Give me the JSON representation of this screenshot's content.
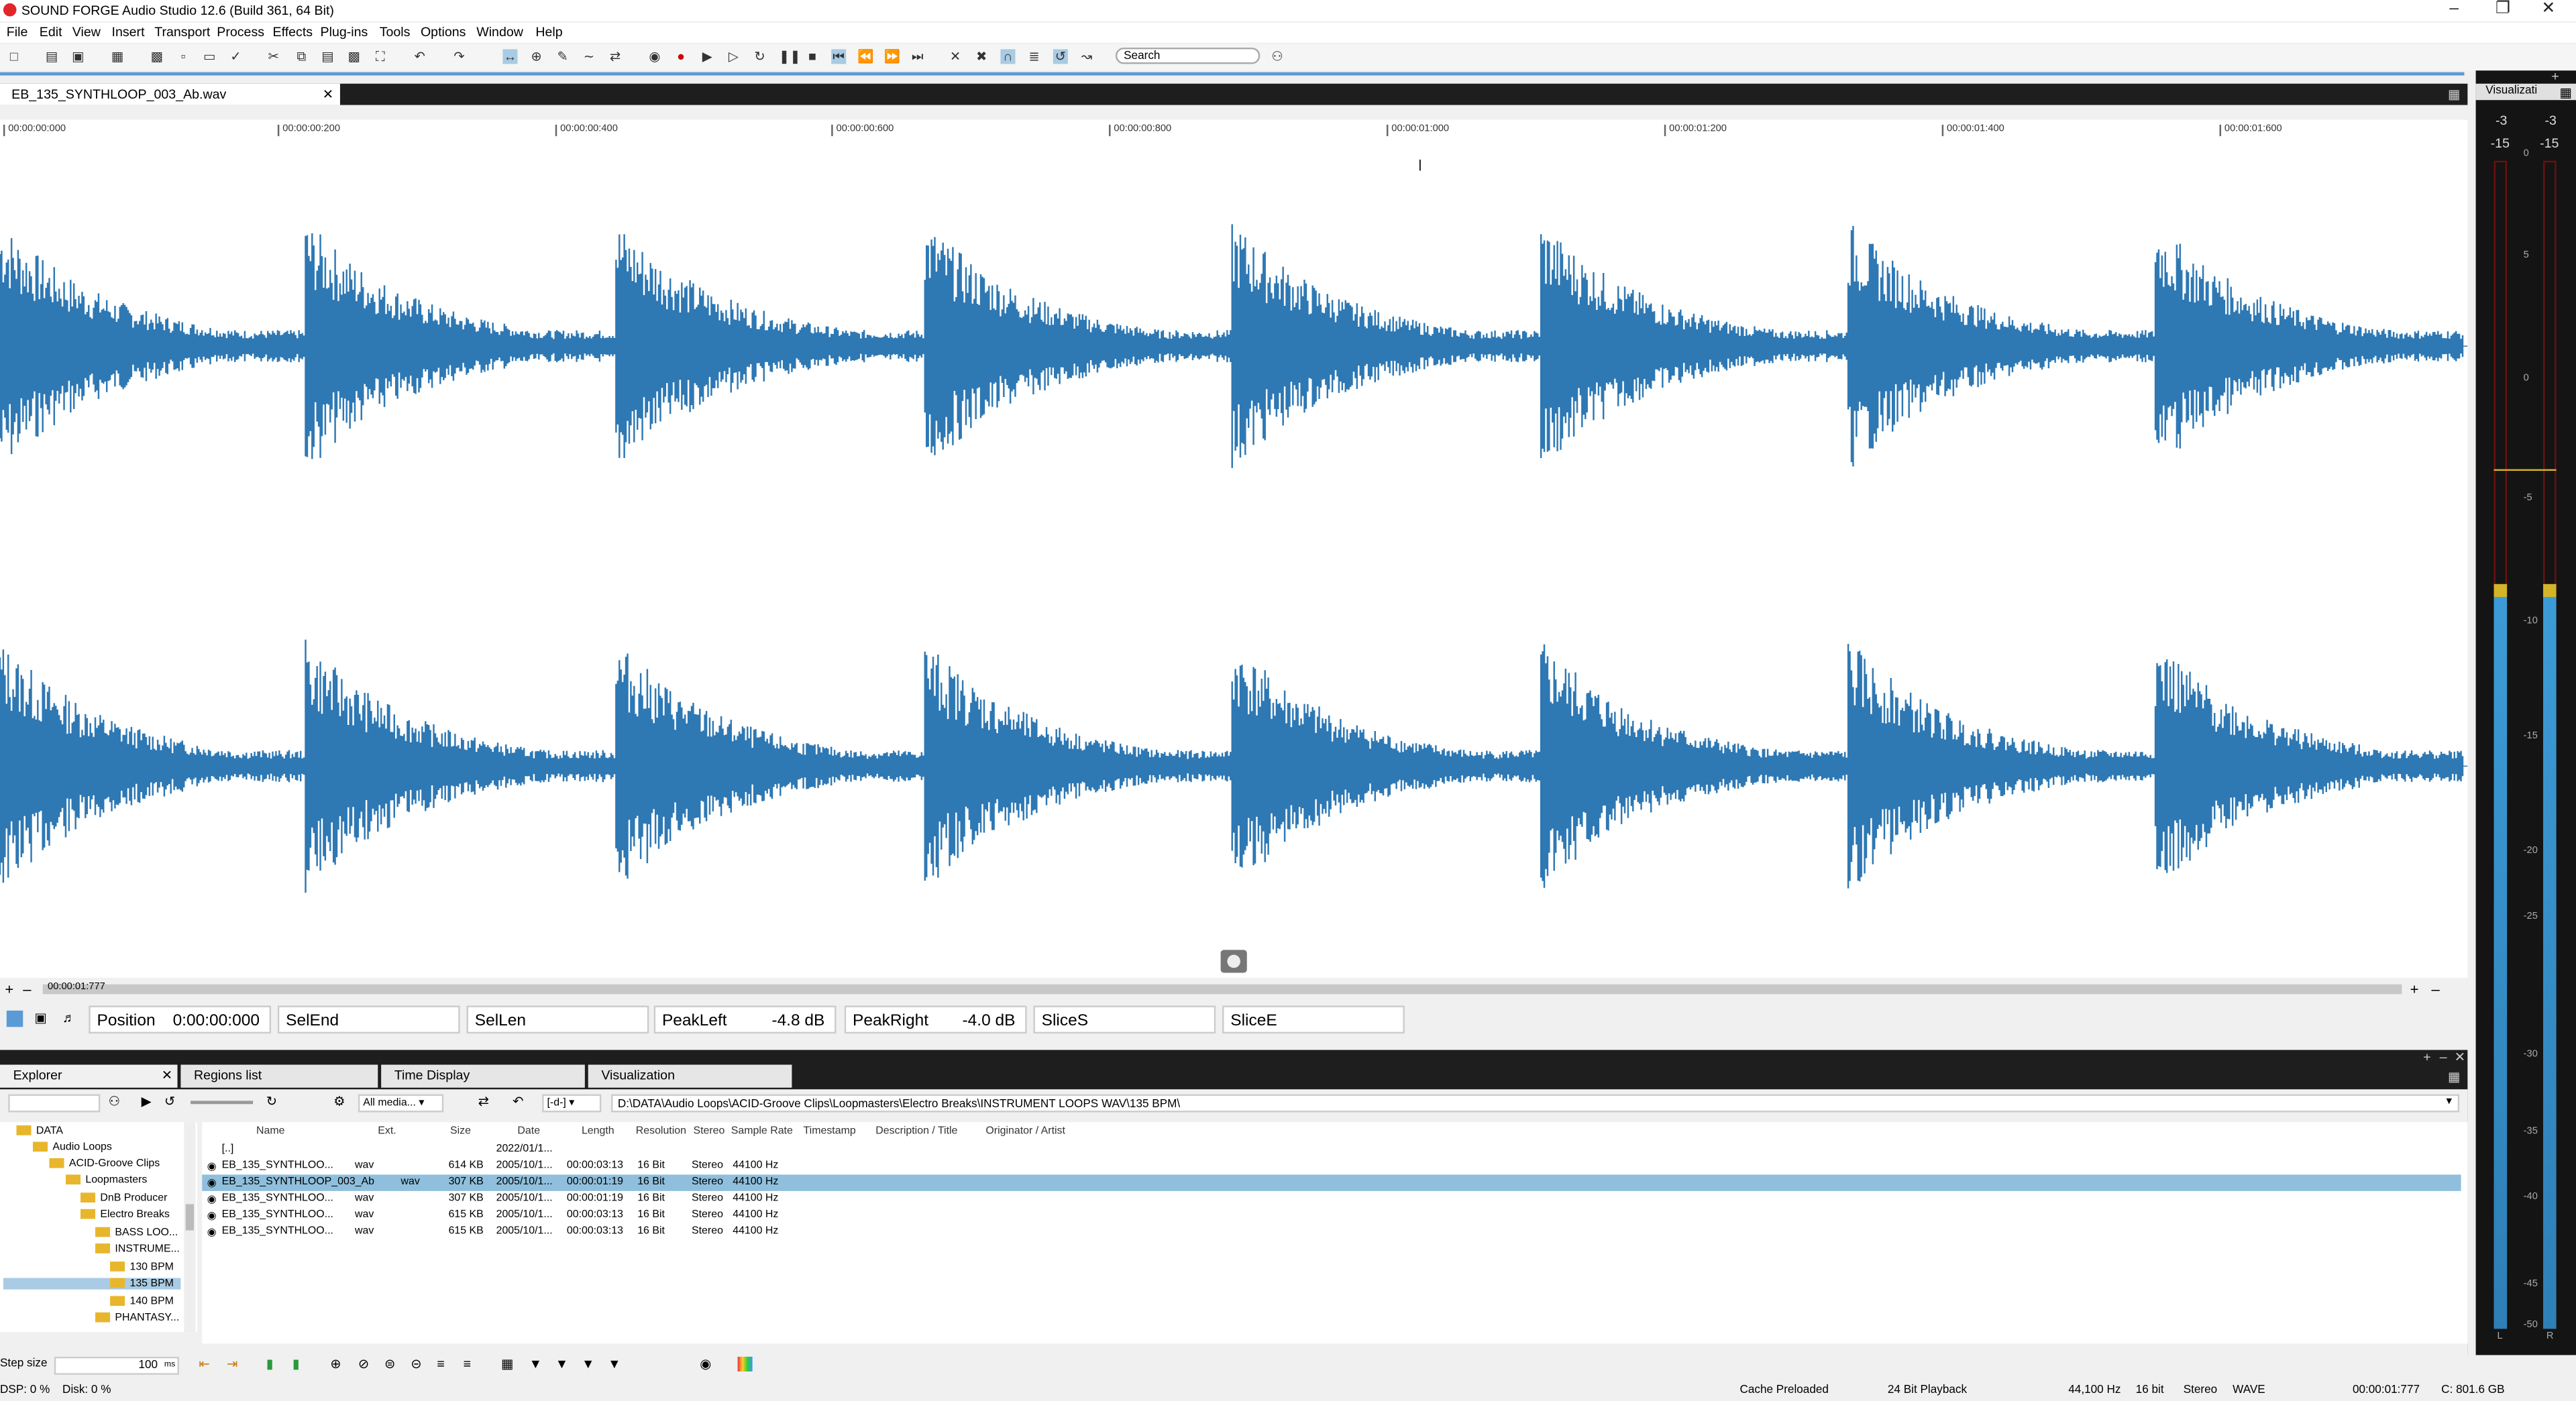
{
  "title": "SOUND FORGE Audio Studio 12.6 (Build 361, 64 Bit)",
  "menu": [
    "File",
    "Edit",
    "View",
    "Insert",
    "Transport",
    "Process",
    "Effects",
    "Plug-ins",
    "Tools",
    "Options",
    "Window",
    "Help"
  ],
  "search": {
    "placeholder": "Search"
  },
  "doc_tab": {
    "label": "EB_135_SYNTHLOOP_003_Ab.wav"
  },
  "ruler_ticks": [
    "00:00:00:000",
    "00:00:00:200",
    "00:00:00:400",
    "00:00:00:600",
    "00:00:00:800",
    "00:00:01:000",
    "00:00:01:200",
    "00:00:01:400",
    "00:00:01:600"
  ],
  "scroll_time": "00:00:01:777",
  "status_fields": {
    "position": {
      "label": "Position",
      "value": "0:00:00:000"
    },
    "selend": {
      "label": "SelEnd"
    },
    "sellen": {
      "label": "SelLen"
    },
    "peakleft": {
      "label": "PeakLeft",
      "value": "-4.8 dB"
    },
    "peakright": {
      "label": "PeakRight",
      "value": "-4.0 dB"
    },
    "slices": {
      "label": "SliceS"
    },
    "slicee": {
      "label": "SliceE"
    }
  },
  "pane_tabs": {
    "explorer": "Explorer",
    "regions": "Regions list",
    "time_display": "Time Display",
    "visualization": "Visualization"
  },
  "media_filter": "All media...",
  "drive": "[-d-]",
  "path": "D:\\DATA\\Audio Loops\\ACID-Groove Clips\\Loopmasters\\Electro Breaks\\INSTRUMENT LOOPS  WAV\\135 BPM\\",
  "tree": [
    {
      "label": "DATA",
      "indent": 0
    },
    {
      "label": "Audio Loops",
      "indent": 1
    },
    {
      "label": "ACID-Groove Clips",
      "indent": 2
    },
    {
      "label": "Loopmasters",
      "indent": 3
    },
    {
      "label": "DnB Producer",
      "indent": 4
    },
    {
      "label": "Electro Breaks",
      "indent": 4
    },
    {
      "label": "BASS LOO...",
      "indent": 5
    },
    {
      "label": "INSTRUME...",
      "indent": 5
    },
    {
      "label": "130 BPM",
      "indent": 6
    },
    {
      "label": "135 BPM",
      "indent": 6,
      "selected": true
    },
    {
      "label": "140 BPM",
      "indent": 6
    },
    {
      "label": "PHANTASY...",
      "indent": 5
    }
  ],
  "columns": [
    "Name",
    "Ext.",
    "Size",
    "Date",
    "Length",
    "Resolution",
    "Stereo",
    "Sample Rate",
    "Timestamp",
    "Description / Title",
    "Originator / Artist"
  ],
  "files": [
    {
      "name": "[..]",
      "ext": "",
      "size": "",
      "date": "2022/01/1...",
      "length": "",
      "res": "",
      "stereo": "",
      "rate": ""
    },
    {
      "name": "EB_135_SYNTHLOO...",
      "ext": "wav",
      "size": "614 KB",
      "date": "2005/10/1...",
      "length": "00:00:03:13",
      "res": "16 Bit",
      "stereo": "Stereo",
      "rate": "44100 Hz"
    },
    {
      "name": "EB_135_SYNTHLOOP_003_Ab",
      "ext": "wav",
      "size": "307 KB",
      "date": "2005/10/1...",
      "length": "00:00:01:19",
      "res": "16 Bit",
      "stereo": "Stereo",
      "rate": "44100 Hz",
      "selected": true
    },
    {
      "name": "EB_135_SYNTHLOO...",
      "ext": "wav",
      "size": "307 KB",
      "date": "2005/10/1...",
      "length": "00:00:01:19",
      "res": "16 Bit",
      "stereo": "Stereo",
      "rate": "44100 Hz"
    },
    {
      "name": "EB_135_SYNTHLOO...",
      "ext": "wav",
      "size": "615 KB",
      "date": "2005/10/1...",
      "length": "00:00:03:13",
      "res": "16 Bit",
      "stereo": "Stereo",
      "rate": "44100 Hz"
    },
    {
      "name": "EB_135_SYNTHLOO...",
      "ext": "wav",
      "size": "615 KB",
      "date": "2005/10/1...",
      "length": "00:00:03:13",
      "res": "16 Bit",
      "stereo": "Stereo",
      "rate": "44100 Hz"
    }
  ],
  "step_size": {
    "label": "Step size",
    "value": "100",
    "unit": "ms"
  },
  "status_bar": {
    "dsp": "DSP: 0 %",
    "disk": "Disk:  0 %",
    "cache": "Cache Preloaded",
    "playback": "24 Bit Playback",
    "rate": "44,100 Hz",
    "bits": "16 bit",
    "channels": "Stereo",
    "format": "WAVE",
    "length": "00:00:01:777",
    "free": "C: 801.6 GB"
  },
  "meter": {
    "title": "Visualizati",
    "peak_l": "-3",
    "peak_r": "-3",
    "rms_l": "-15",
    "rms_r": "-15",
    "scale": [
      "0",
      "5",
      "0",
      "-5",
      "-10",
      "-15",
      "-20",
      "-25",
      "-30",
      "-35",
      "-40",
      "-45",
      "-50"
    ],
    "ch_l": "L",
    "ch_r": "R"
  },
  "colors": {
    "waveform": "#2e78b4",
    "selection": "#a9cbe3",
    "accent": "#5b9bd5"
  }
}
